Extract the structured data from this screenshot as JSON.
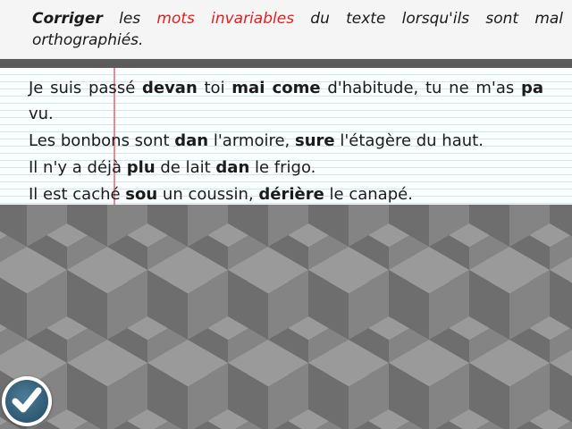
{
  "instruction": {
    "kw": "Corriger",
    "pre": "les",
    "accent": "mots invariables",
    "post": "du texte lorsqu'ils sont mal orthographiés."
  },
  "sentences": [
    [
      {
        "t": "Je suis passé ",
        "b": false
      },
      {
        "t": "devan",
        "b": true
      },
      {
        "t": " toi ",
        "b": false
      },
      {
        "t": "mai come",
        "b": true
      },
      {
        "t": " d'habitude, tu ne m'as ",
        "b": false
      },
      {
        "t": "pa",
        "b": true
      },
      {
        "t": " vu.",
        "b": false
      }
    ],
    [
      {
        "t": "Les bonbons sont ",
        "b": false
      },
      {
        "t": "dan",
        "b": true
      },
      {
        "t": " l'armoire, ",
        "b": false
      },
      {
        "t": "sure",
        "b": true
      },
      {
        "t": " l'étagère du haut.",
        "b": false
      }
    ],
    [
      {
        "t": "Il n'y a déjà ",
        "b": false
      },
      {
        "t": "plu",
        "b": true
      },
      {
        "t": " de lait ",
        "b": false
      },
      {
        "t": "dan",
        "b": true
      },
      {
        "t": " le frigo.",
        "b": false
      }
    ],
    [
      {
        "t": "Il est caché ",
        "b": false
      },
      {
        "t": "sou",
        "b": true
      },
      {
        "t": " un coussin, ",
        "b": false
      },
      {
        "t": "dérière",
        "b": true
      },
      {
        "t": " le canapé.",
        "b": false
      }
    ]
  ],
  "colors": {
    "accent": "#e02020",
    "cube_top": "#9a9a9a",
    "cube_left": "#6e6e6e",
    "cube_right": "#848484",
    "check_button": "#2f5873"
  },
  "icons": {
    "check_button": "checkmark-icon"
  }
}
